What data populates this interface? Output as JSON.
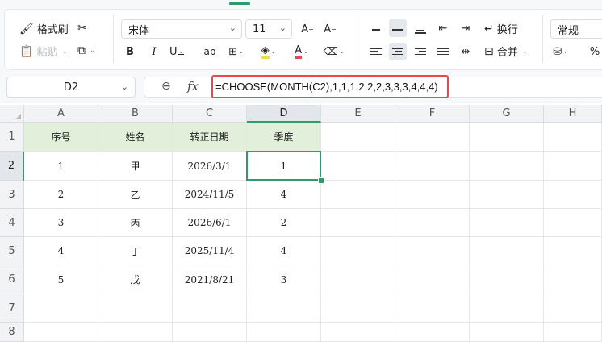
{
  "ribbon": {
    "format_painter": "格式刷",
    "paste": "粘贴",
    "font_name": "宋体",
    "font_size": "11",
    "wrap_text": "换行",
    "merge": "合并",
    "number_format": "常规",
    "percent": "%",
    "bold": "B",
    "italic": "I",
    "underline": "U",
    "strike": "ab",
    "font_color_a": "A",
    "increase_font": "A",
    "decrease_font": "A"
  },
  "formula_bar": {
    "cell_ref": "D2",
    "fx": "fx",
    "formula": "=CHOOSE(MONTH(C2),1,1,1,2,2,2,3,3,3,4,4,4)"
  },
  "sheet": {
    "columns": [
      "A",
      "B",
      "C",
      "D",
      "E",
      "F",
      "G",
      "H"
    ],
    "rows": [
      "1",
      "2",
      "3",
      "4",
      "5",
      "6",
      "7",
      "8"
    ],
    "header_cells": [
      "序号",
      "姓名",
      "转正日期",
      "季度"
    ],
    "data": [
      [
        "1",
        "甲",
        "2026/3/1",
        "1"
      ],
      [
        "2",
        "乙",
        "2024/11/5",
        "4"
      ],
      [
        "3",
        "丙",
        "2026/6/1",
        "2"
      ],
      [
        "4",
        "丁",
        "2025/11/4",
        "4"
      ],
      [
        "5",
        "戊",
        "2021/8/21",
        "3"
      ]
    ],
    "active_cell": "D2"
  },
  "colors": {
    "accent": "#2f9a6a",
    "header_fill": "#e2efda",
    "highlight": "#e5484d",
    "font_color_bar": "#e5484d"
  }
}
